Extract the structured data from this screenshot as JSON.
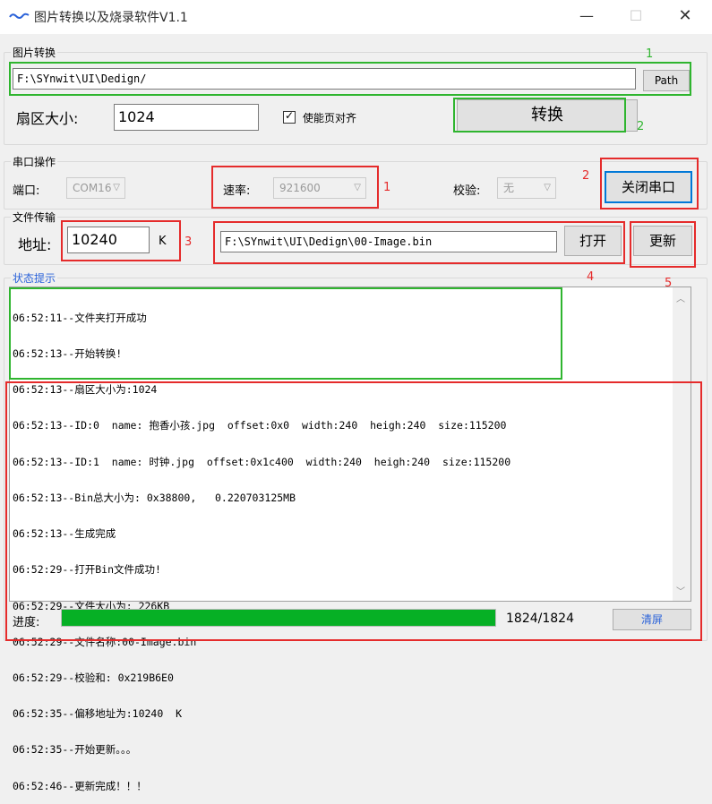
{
  "window": {
    "title": "图片转换以及烧录软件V1.1",
    "controls": [
      "—",
      "☐",
      "✕"
    ]
  },
  "image_convert": {
    "legend": "图片转换",
    "path_value": "F:\\SYnwit\\UI\\Dedign/",
    "path_button": "Path",
    "sector_label": "扇区大小:",
    "sector_value": "1024",
    "align_checkbox_label": "使能页对齐",
    "align_checked": true,
    "convert_button": "转换"
  },
  "serial": {
    "legend": "串口操作",
    "port_label": "端口:",
    "port_value": "COM16",
    "baud_label": "速率:",
    "baud_value": "921600",
    "parity_label": "校验:",
    "parity_value": "无",
    "close_button": "关闭串口"
  },
  "file_transfer": {
    "legend": "文件传输",
    "address_label": "地址:",
    "address_value": "10240",
    "address_unit": "K",
    "file_path": "F:\\SYnwit\\UI\\Dedign\\00-Image.bin",
    "open_button": "打开",
    "update_button": "更新"
  },
  "status": {
    "legend": "状态提示",
    "lines": [
      "06:52:11--文件夹打开成功",
      "06:52:13--开始转换!",
      "06:52:13--扇区大小为:1024",
      "06:52:13--ID:0  name: 抱香小孩.jpg  offset:0x0  width:240  heigh:240  size:115200",
      "06:52:13--ID:1  name: 时钟.jpg  offset:0x1c400  width:240  heigh:240  size:115200",
      "06:52:13--Bin总大小为: 0x38800,   0.220703125MB",
      "06:52:13--生成完成",
      "06:52:29--打开Bin文件成功!",
      "06:52:29--文件大小为: 226KB",
      "06:52:29--文件名称:00-Image.bin",
      "06:52:29--校验和: 0x219B6E0",
      "06:52:35--偏移地址为:10240  K",
      "06:52:35--开始更新。。。",
      "06:52:46--更新完成！！！"
    ]
  },
  "progress": {
    "label": "进度:",
    "fraction": 1.0,
    "text": "1824/1824",
    "clear_button": "清屏"
  },
  "annotations": {
    "a1_green": "1",
    "a2_green": "2",
    "a1_red": "1",
    "a2_red": "2",
    "a3_red": "3",
    "a4_red": "4",
    "a5_red": "5"
  },
  "colors": {
    "annotation_red": "#e52b2b",
    "annotation_green": "#2fb52f",
    "progress_green": "#06b025",
    "legend_blue": "#2a62d9",
    "focus_blue": "#0078d7"
  }
}
